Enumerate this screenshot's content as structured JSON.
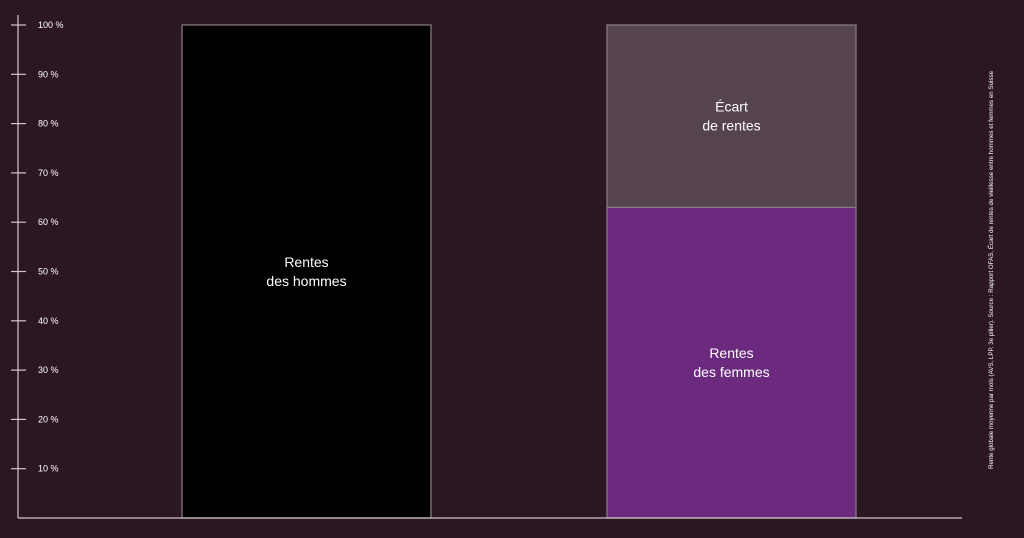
{
  "chart_data": {
    "type": "bar",
    "stacked": true,
    "ylim": [
      0,
      100
    ],
    "y_ticks": [
      10,
      20,
      30,
      40,
      50,
      60,
      70,
      80,
      90,
      100
    ],
    "y_tick_labels": [
      "10 %",
      "20 %",
      "30 %",
      "40 %",
      "50 %",
      "60 %",
      "70 %",
      "80 %",
      "90 %",
      "100 %"
    ],
    "grid": false,
    "bars": [
      {
        "segments": [
          {
            "value": 100,
            "label": [
              "Rentes",
              "des hommes"
            ],
            "color": "#000000"
          }
        ]
      },
      {
        "segments": [
          {
            "value": 63,
            "label": [
              "Rentes",
              "des femmes"
            ],
            "color": "#6b2a7e"
          },
          {
            "value": 37,
            "label": [
              "Écart",
              "de rentes"
            ],
            "color": "#55434e"
          }
        ]
      }
    ],
    "source_note": "Rente globale moyenne par mois (AVS, LPP, 3e pilier). Source : Rapport OFAS, Écart de rentes de vieillesse entre hommes et femmes en Suisse"
  },
  "colors": {
    "background": "#2c1623",
    "axis": "#cfc6cc",
    "bar_outline": "#8a7f86",
    "text": "#ffffff"
  }
}
